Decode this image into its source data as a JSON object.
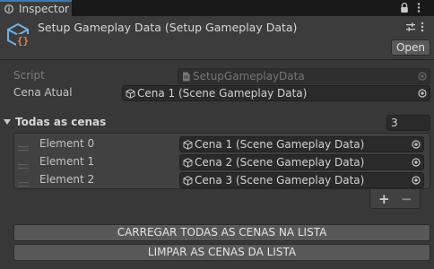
{
  "tab": {
    "label": "Inspector",
    "icon": "info-icon"
  },
  "header": {
    "title": "Setup Gameplay Data (Setup Gameplay Data)",
    "open_label": "Open",
    "icon": "script-asset-icon"
  },
  "fields": {
    "script": {
      "label": "Script",
      "value": "SetupGameplayData"
    },
    "cena_atual": {
      "label": "Cena Atual",
      "value": "Cena 1 (Scene Gameplay Data)"
    }
  },
  "list": {
    "label": "Todas as cenas",
    "size": "3",
    "elements": [
      {
        "label": "Element 0",
        "value": "Cena 1 (Scene Gameplay Data)"
      },
      {
        "label": "Element 1",
        "value": "Cena 2 (Scene Gameplay Data)"
      },
      {
        "label": "Element 2",
        "value": "Cena 3 (Scene Gameplay Data)"
      }
    ],
    "add_label": "+",
    "remove_label": "−"
  },
  "buttons": {
    "load_all": "CARREGAR TODAS AS CENAS NA LISTA",
    "clear": "LIMPAR AS CENAS DA LISTA"
  },
  "colors": {
    "background": "#383838",
    "tab_accent": "#3a79bb",
    "field": "#2a2a2a",
    "button": "#585858",
    "script_icon_orange": "#e8823a",
    "script_icon_blue": "#6fb2e6"
  }
}
